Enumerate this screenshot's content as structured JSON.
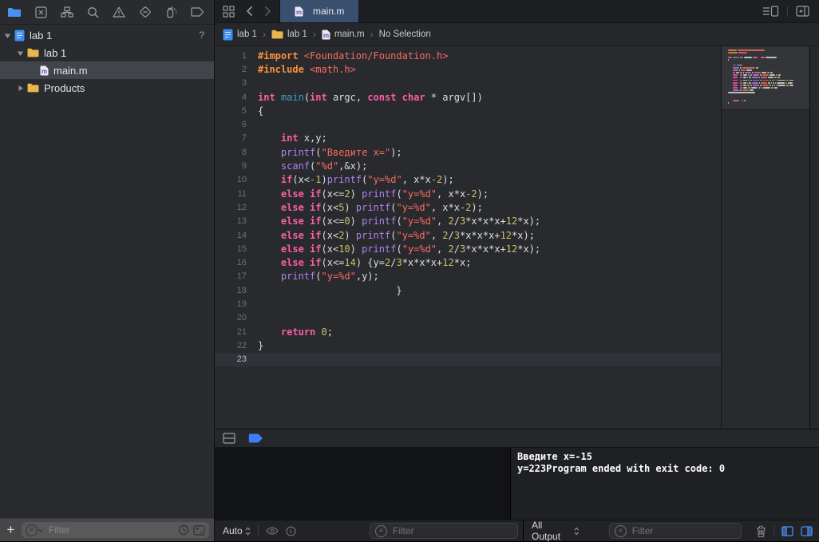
{
  "colors": {
    "keyword": "#fc5fa3",
    "string": "#fc6a5d",
    "number": "#d0bf69",
    "preprocessor": "#fd8f3f",
    "function": "#b281eb",
    "declaration": "#41a1c0",
    "plain": "#dfdfe0",
    "accent": "#4a90f4",
    "tab_selected": "#3a4f6e"
  },
  "navigator_bar": {
    "icons": [
      "project-navigator",
      "source-control-navigator",
      "symbol-navigator",
      "find-navigator",
      "issue-navigator",
      "test-navigator",
      "debug-navigator",
      "breakpoint-navigator",
      "report-navigator"
    ]
  },
  "sidebar": {
    "items": [
      {
        "label": "lab 1",
        "icon": "project",
        "disclosure": "open",
        "indent": 0,
        "badge": "?"
      },
      {
        "label": "lab 1",
        "icon": "folder",
        "disclosure": "open",
        "indent": 1
      },
      {
        "label": "main.m",
        "icon": "mfile",
        "disclosure": "none",
        "indent": 2,
        "selected": true
      },
      {
        "label": "Products",
        "icon": "folder",
        "disclosure": "closed",
        "indent": 1
      }
    ],
    "filter_placeholder": "Filter"
  },
  "tabbar": {
    "tabs": [
      {
        "label": "main.m",
        "active": true
      }
    ]
  },
  "jumpbar": {
    "items": [
      {
        "label": "lab 1",
        "icon": "project"
      },
      {
        "label": "lab 1",
        "icon": "folder"
      },
      {
        "label": "main.m",
        "icon": "mfile"
      },
      {
        "label": "No Selection",
        "icon": "none"
      }
    ]
  },
  "editor": {
    "current_line": 23,
    "lines": [
      {
        "segs": [
          [
            "pre",
            "#import "
          ],
          [
            "str",
            "<Foundation/Foundation.h>"
          ]
        ]
      },
      {
        "segs": [
          [
            "pre",
            "#include "
          ],
          [
            "str",
            "<math.h>"
          ]
        ]
      },
      {
        "segs": []
      },
      {
        "segs": [
          [
            "kw",
            "int "
          ],
          [
            "decl",
            "main"
          ],
          [
            "pln",
            "("
          ],
          [
            "kw",
            "int"
          ],
          [
            "pln",
            " argc, "
          ],
          [
            "kw",
            "const"
          ],
          [
            "pln",
            " "
          ],
          [
            "kw",
            "char"
          ],
          [
            "pln",
            " * argv[])"
          ]
        ]
      },
      {
        "segs": [
          [
            "pln",
            "{"
          ]
        ]
      },
      {
        "segs": []
      },
      {
        "segs": [
          [
            "pln",
            "    "
          ],
          [
            "kw",
            "int"
          ],
          [
            "pln",
            " x,y;"
          ]
        ]
      },
      {
        "segs": [
          [
            "pln",
            "    "
          ],
          [
            "fn",
            "printf"
          ],
          [
            "pln",
            "("
          ],
          [
            "str",
            "\"Введите x=\""
          ],
          [
            "pln",
            ");"
          ]
        ]
      },
      {
        "segs": [
          [
            "pln",
            "    "
          ],
          [
            "fn",
            "scanf"
          ],
          [
            "pln",
            "("
          ],
          [
            "str",
            "\"%d\""
          ],
          [
            "pln",
            ",&x);"
          ]
        ]
      },
      {
        "segs": [
          [
            "pln",
            "    "
          ],
          [
            "kw",
            "if"
          ],
          [
            "pln",
            "(x<"
          ],
          [
            "num",
            "-1"
          ],
          [
            "pln",
            ")"
          ],
          [
            "fn",
            "printf"
          ],
          [
            "pln",
            "("
          ],
          [
            "str",
            "\"y=%d\""
          ],
          [
            "pln",
            ", x*x"
          ],
          [
            "num",
            "-2"
          ],
          [
            "pln",
            ");"
          ]
        ]
      },
      {
        "segs": [
          [
            "pln",
            "    "
          ],
          [
            "kw",
            "else"
          ],
          [
            "pln",
            " "
          ],
          [
            "kw",
            "if"
          ],
          [
            "pln",
            "(x<="
          ],
          [
            "num",
            "2"
          ],
          [
            "pln",
            ") "
          ],
          [
            "fn",
            "printf"
          ],
          [
            "pln",
            "("
          ],
          [
            "str",
            "\"y=%d\""
          ],
          [
            "pln",
            ", x*x"
          ],
          [
            "num",
            "-2"
          ],
          [
            "pln",
            ");"
          ]
        ]
      },
      {
        "segs": [
          [
            "pln",
            "    "
          ],
          [
            "kw",
            "else"
          ],
          [
            "pln",
            " "
          ],
          [
            "kw",
            "if"
          ],
          [
            "pln",
            "(x<"
          ],
          [
            "num",
            "5"
          ],
          [
            "pln",
            ") "
          ],
          [
            "fn",
            "printf"
          ],
          [
            "pln",
            "("
          ],
          [
            "str",
            "\"y=%d\""
          ],
          [
            "pln",
            ", x*x"
          ],
          [
            "num",
            "-2"
          ],
          [
            "pln",
            ");"
          ]
        ]
      },
      {
        "segs": [
          [
            "pln",
            "    "
          ],
          [
            "kw",
            "else"
          ],
          [
            "pln",
            " "
          ],
          [
            "kw",
            "if"
          ],
          [
            "pln",
            "(x<="
          ],
          [
            "num",
            "0"
          ],
          [
            "pln",
            ") "
          ],
          [
            "fn",
            "printf"
          ],
          [
            "pln",
            "("
          ],
          [
            "str",
            "\"y=%d\""
          ],
          [
            "pln",
            ", "
          ],
          [
            "num",
            "2"
          ],
          [
            "pln",
            "/"
          ],
          [
            "num",
            "3"
          ],
          [
            "pln",
            "*x*x*x+"
          ],
          [
            "num",
            "12"
          ],
          [
            "pln",
            "*x);"
          ]
        ]
      },
      {
        "segs": [
          [
            "pln",
            "    "
          ],
          [
            "kw",
            "else"
          ],
          [
            "pln",
            " "
          ],
          [
            "kw",
            "if"
          ],
          [
            "pln",
            "(x<"
          ],
          [
            "num",
            "2"
          ],
          [
            "pln",
            ") "
          ],
          [
            "fn",
            "printf"
          ],
          [
            "pln",
            "("
          ],
          [
            "str",
            "\"y=%d\""
          ],
          [
            "pln",
            ", "
          ],
          [
            "num",
            "2"
          ],
          [
            "pln",
            "/"
          ],
          [
            "num",
            "3"
          ],
          [
            "pln",
            "*x*x*x+"
          ],
          [
            "num",
            "12"
          ],
          [
            "pln",
            "*x);"
          ]
        ]
      },
      {
        "segs": [
          [
            "pln",
            "    "
          ],
          [
            "kw",
            "else"
          ],
          [
            "pln",
            " "
          ],
          [
            "kw",
            "if"
          ],
          [
            "pln",
            "(x<"
          ],
          [
            "num",
            "10"
          ],
          [
            "pln",
            ") "
          ],
          [
            "fn",
            "printf"
          ],
          [
            "pln",
            "("
          ],
          [
            "str",
            "\"y=%d\""
          ],
          [
            "pln",
            ", "
          ],
          [
            "num",
            "2"
          ],
          [
            "pln",
            "/"
          ],
          [
            "num",
            "3"
          ],
          [
            "pln",
            "*x*x*x+"
          ],
          [
            "num",
            "12"
          ],
          [
            "pln",
            "*x);"
          ]
        ]
      },
      {
        "segs": [
          [
            "pln",
            "    "
          ],
          [
            "kw",
            "else"
          ],
          [
            "pln",
            " "
          ],
          [
            "kw",
            "if"
          ],
          [
            "pln",
            "(x<="
          ],
          [
            "num",
            "14"
          ],
          [
            "pln",
            ") {y="
          ],
          [
            "num",
            "2"
          ],
          [
            "pln",
            "/"
          ],
          [
            "num",
            "3"
          ],
          [
            "pln",
            "*x*x*x+"
          ],
          [
            "num",
            "12"
          ],
          [
            "pln",
            "*x;"
          ]
        ]
      },
      {
        "segs": [
          [
            "pln",
            "    "
          ],
          [
            "fn",
            "printf"
          ],
          [
            "pln",
            "("
          ],
          [
            "str",
            "\"y=%d\""
          ],
          [
            "pln",
            ",y);"
          ]
        ]
      },
      {
        "segs": [
          [
            "pln",
            "                        }"
          ]
        ]
      },
      {
        "segs": []
      },
      {
        "segs": []
      },
      {
        "segs": [
          [
            "pln",
            "    "
          ],
          [
            "kw",
            "return"
          ],
          [
            "pln",
            " "
          ],
          [
            "num",
            "0"
          ],
          [
            "pln",
            ";"
          ]
        ]
      },
      {
        "segs": [
          [
            "pln",
            "}"
          ]
        ]
      },
      {
        "segs": [],
        "current": true
      }
    ]
  },
  "debug": {
    "variables_scope": "Auto",
    "output_scope": "All Output",
    "variables_filter_placeholder": "Filter",
    "console_filter_placeholder": "Filter",
    "console_lines": [
      "Введите x=-15",
      "y=223Program ended with exit code: 0"
    ]
  }
}
